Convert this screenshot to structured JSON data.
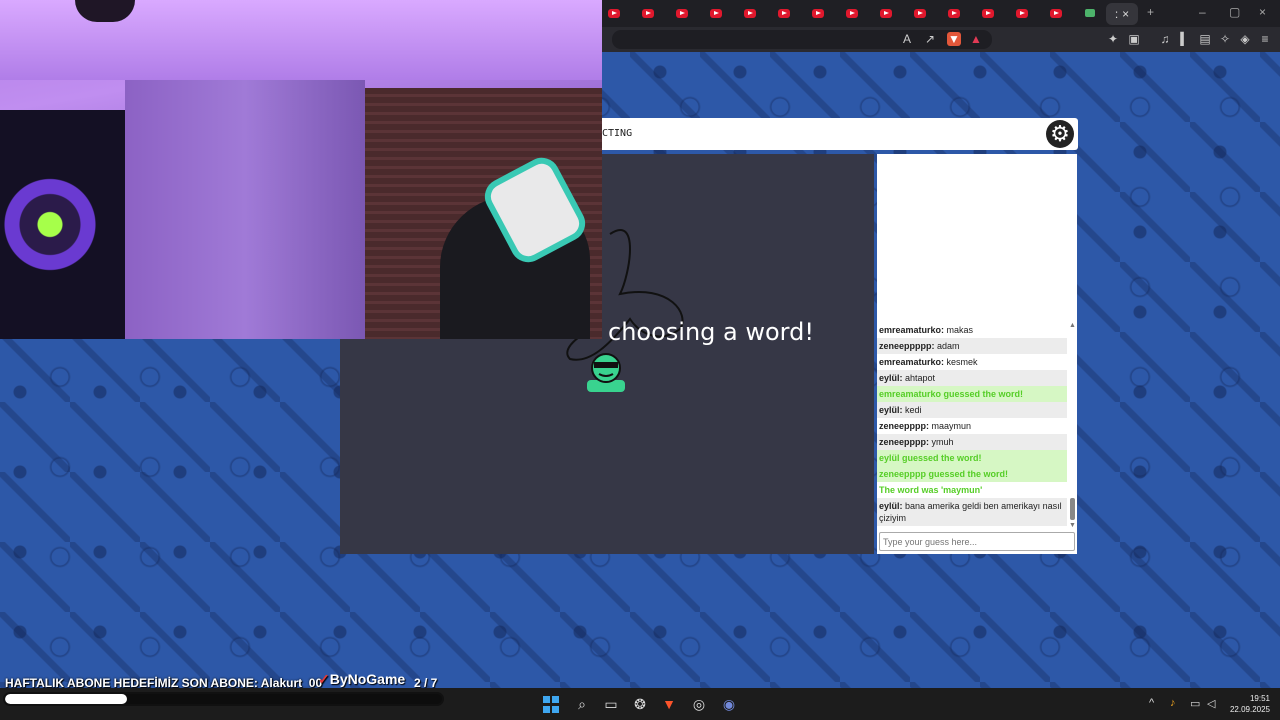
{
  "browser": {
    "active_tab_close": "×",
    "new_tab": "+",
    "window_controls": [
      "–",
      "▢",
      "×"
    ]
  },
  "game": {
    "header_text": "CTING",
    "overlay_text": "choosing a word!",
    "chat": {
      "messages": [
        {
          "user": "emreamaturko:",
          "text": "makas",
          "type": "normal"
        },
        {
          "user": "zeneeppppp:",
          "text": "adam",
          "type": "alt"
        },
        {
          "user": "emreamaturko:",
          "text": "kesmek",
          "type": "normal"
        },
        {
          "user": "eylül:",
          "text": "ahtapot",
          "type": "alt"
        },
        {
          "user": "",
          "text": "emreamaturko guessed the word!",
          "type": "green-hl"
        },
        {
          "user": "eylül:",
          "text": "kedi",
          "type": "alt"
        },
        {
          "user": "zeneepppp:",
          "text": "maaymun",
          "type": "normal"
        },
        {
          "user": "zeneepppp:",
          "text": "ymuh",
          "type": "alt"
        },
        {
          "user": "",
          "text": "eylül guessed the word!",
          "type": "green-hl"
        },
        {
          "user": "",
          "text": "zeneepppp guessed the word!",
          "type": "green-hl"
        },
        {
          "user": "",
          "text": "The word was 'maymun'",
          "type": "green"
        },
        {
          "user": "eylül:",
          "text": "bana amerika geldi ben amerikayı nasıl çiziyim",
          "type": "alt-two"
        }
      ],
      "input_placeholder": "Type your guess here..."
    }
  },
  "stream_overlay": {
    "subscriber_text": "HAFTALIK ABONE HEDEFİMİZ SON ABONE: Alakurt_00",
    "brand": "ByNoGame",
    "counter": "2  / 7",
    "progress_fraction": 0.28
  },
  "taskbar": {
    "time": "19:51",
    "date": "22.09.2025"
  }
}
